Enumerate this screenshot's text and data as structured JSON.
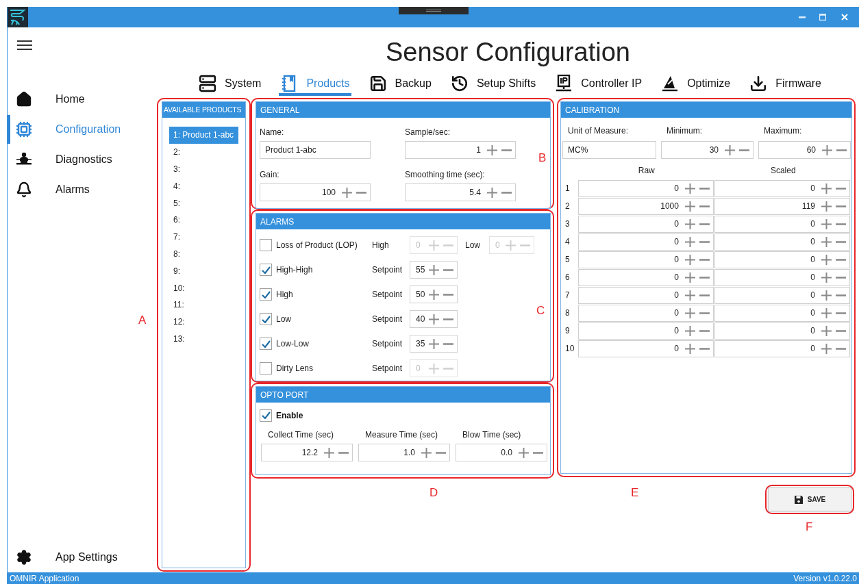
{
  "sidebar": {
    "items": [
      {
        "label": "Home",
        "selected": false
      },
      {
        "label": "Configuration",
        "selected": true
      },
      {
        "label": "Diagnostics",
        "selected": false
      },
      {
        "label": "Alarms",
        "selected": false
      }
    ],
    "footer_item": {
      "label": "App Settings"
    }
  },
  "page_title": "Sensor Configuration",
  "tabs": [
    {
      "label": "System",
      "selected": false
    },
    {
      "label": "Products",
      "selected": true
    },
    {
      "label": "Backup",
      "selected": false
    },
    {
      "label": "Setup Shifts",
      "selected": false
    },
    {
      "label": "Controller IP",
      "selected": false
    },
    {
      "label": "Optimize",
      "selected": false
    },
    {
      "label": "Firmware",
      "selected": false
    }
  ],
  "available_products": {
    "title": "AVAILABLE PRODUCTS",
    "items": [
      {
        "label": "1: Product 1-abc",
        "selected": true
      },
      {
        "label": "2:",
        "selected": false
      },
      {
        "label": "3:",
        "selected": false
      },
      {
        "label": "4:",
        "selected": false
      },
      {
        "label": "5:",
        "selected": false
      },
      {
        "label": "6:",
        "selected": false
      },
      {
        "label": "7:",
        "selected": false
      },
      {
        "label": "8:",
        "selected": false
      },
      {
        "label": "9:",
        "selected": false
      },
      {
        "label": "10:",
        "selected": false
      },
      {
        "label": "11:",
        "selected": false
      },
      {
        "label": "12:",
        "selected": false
      },
      {
        "label": "13:",
        "selected": false
      }
    ]
  },
  "general": {
    "title": "GENERAL",
    "fields": [
      {
        "label": "Name:",
        "kind": "text",
        "value": "Product 1-abc"
      },
      {
        "label": "Sample/sec:",
        "kind": "spinner",
        "value": "1"
      },
      {
        "label": "Gain:",
        "kind": "spinner",
        "value": "100"
      },
      {
        "label": "Smoothing time (sec):",
        "kind": "spinner",
        "value": "5.4"
      }
    ]
  },
  "alarms": {
    "title": "ALARMS",
    "rows": [
      {
        "label": "Loss of Product (LOP)",
        "checked": false,
        "setpoints": [
          {
            "label": "High",
            "value": "0",
            "disabled": true
          },
          {
            "label": "Low",
            "value": "0",
            "disabled": true
          }
        ]
      },
      {
        "label": "High-High",
        "checked": true,
        "setpoints": [
          {
            "label": "Setpoint",
            "value": "55",
            "disabled": false
          }
        ]
      },
      {
        "label": "High",
        "checked": true,
        "setpoints": [
          {
            "label": "Setpoint",
            "value": "50",
            "disabled": false
          }
        ]
      },
      {
        "label": "Low",
        "checked": true,
        "setpoints": [
          {
            "label": "Setpoint",
            "value": "40",
            "disabled": false
          }
        ]
      },
      {
        "label": "Low-Low",
        "checked": true,
        "setpoints": [
          {
            "label": "Setpoint",
            "value": "35",
            "disabled": false
          }
        ]
      },
      {
        "label": "Dirty Lens",
        "checked": false,
        "setpoints": [
          {
            "label": "Setpoint",
            "value": "0",
            "disabled": true
          }
        ]
      }
    ]
  },
  "opto_port": {
    "title": "OPTO PORT",
    "enable": {
      "label": "Enable",
      "checked": true
    },
    "fields": [
      {
        "label": "Collect Time (sec)",
        "value": "12.2"
      },
      {
        "label": "Measure Time (sec)",
        "value": "1.0"
      },
      {
        "label": "Blow Time (sec)",
        "value": "0.0"
      }
    ]
  },
  "calibration": {
    "title": "CALIBRATION",
    "fields": [
      {
        "label": "Unit of Measure:",
        "kind": "text",
        "value": "MC%"
      },
      {
        "label": "Minimum:",
        "kind": "spinner",
        "value": "30"
      },
      {
        "label": "Maximum:",
        "kind": "spinner",
        "value": "60"
      }
    ],
    "columns": [
      "Raw",
      "Scaled"
    ],
    "rows": [
      {
        "index": "1",
        "raw": "0",
        "scaled": "0"
      },
      {
        "index": "2",
        "raw": "1000",
        "scaled": "119"
      },
      {
        "index": "3",
        "raw": "0",
        "scaled": "0"
      },
      {
        "index": "4",
        "raw": "0",
        "scaled": "0"
      },
      {
        "index": "5",
        "raw": "0",
        "scaled": "0"
      },
      {
        "index": "6",
        "raw": "0",
        "scaled": "0"
      },
      {
        "index": "7",
        "raw": "0",
        "scaled": "0"
      },
      {
        "index": "8",
        "raw": "0",
        "scaled": "0"
      },
      {
        "index": "9",
        "raw": "0",
        "scaled": "0"
      },
      {
        "index": "10",
        "raw": "0",
        "scaled": "0"
      }
    ]
  },
  "save_button": {
    "label": "SAVE"
  },
  "annotations": [
    {
      "label": "A"
    },
    {
      "label": "B"
    },
    {
      "label": "C"
    },
    {
      "label": "D"
    },
    {
      "label": "E"
    },
    {
      "label": "F"
    }
  ],
  "status_bar": {
    "left": "OMNIR Application",
    "right": "Version v1.0.22.0"
  }
}
